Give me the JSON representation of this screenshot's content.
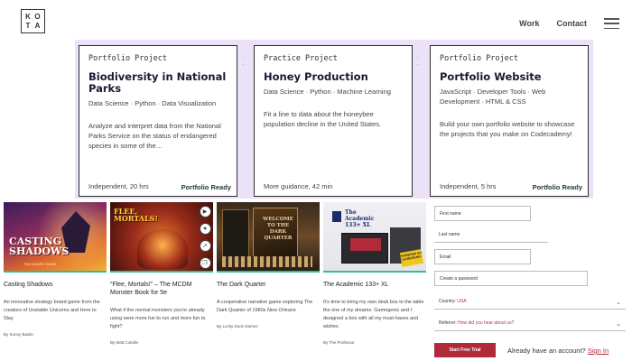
{
  "logo": {
    "letters": [
      "K",
      "O",
      "T",
      "A"
    ]
  },
  "nav": {
    "work": "Work",
    "contact": "Contact",
    "menu_icon": "hamburger-icon"
  },
  "cards": [
    {
      "kicker": "Portfolio Project",
      "title": "Biodiversity in National Parks",
      "tags": "Data Science · Python · Data Visualization",
      "desc": "Analyze and interpret data from the National Parks Service on the status of endangered species in some of the…",
      "meta": "Independent, 20 hrs",
      "badge": "Portfolio Ready"
    },
    {
      "kicker": "Practice Project",
      "title": "Honey Production",
      "tags": "Data Science · Python · Machine Learning",
      "desc": "Fit a line to data about the honeybee population decline in the United States.",
      "meta": "More guidance, 42 min",
      "badge": ""
    },
    {
      "kicker": "Portfolio Project",
      "title": "Portfolio Website",
      "tags": "JavaScript · Developer Tools · Web Development · HTML & CSS",
      "desc": "Build your own portfolio website to showcase the projects that you make on Codecademy!",
      "meta": "Independent, 5 hrs",
      "badge": "Portfolio Ready"
    }
  ],
  "articles": [
    {
      "title": "Casting Shadows",
      "desc": "An innovative strategy board game from the creators of Unstable Unicorns and Here to Slay",
      "by": "By Sunny Basile",
      "thumb_text": "CASTING SHADOWS",
      "thumb_sub": "THE BOARD GAME"
    },
    {
      "title": "“Flee, Mortals!” – The MCDM Monster Book for 5e",
      "desc": "What if the normal monsters you're already using were more fun to run and more fun to fight?",
      "by": "By Matt Colville",
      "thumb_text": "FLEE, MORTALS!"
    },
    {
      "title": "The Dark Quarter",
      "desc": "A cooperative narrative game exploring The Dark Quarter of 1980s New Orleans",
      "by": "By Lucky Duck Games",
      "thumb_text": "WELCOME TO THE DARK QUARTER"
    },
    {
      "title": "The Academic 133+ XL",
      "desc": "It's time to bring my own desk box to the table the one of my dreams. Gamegenic and I designed a box with all my must-haves and wishes",
      "by": "By The Professor",
      "thumb_text": "The Academic 133+ XL",
      "thumb_badge": "POWERED BY GAMEGENIC"
    }
  ],
  "side_icons": [
    "play-icon",
    "heart-icon",
    "share-icon",
    "bookmark-icon"
  ],
  "form": {
    "first_name": "First name",
    "last_name": "Last name",
    "email": "Email",
    "password": "Create a password",
    "country_label": "Country:",
    "country_value": "USA",
    "referrer_label": "Referrer:",
    "referrer_value": "How did you hear about us?",
    "submit": "Start Free Trial",
    "signin_prompt": "Already have an account?",
    "signin_link": "Sign In"
  },
  "colors": {
    "band": "#ece2f8",
    "accent_green": "#2fbf94",
    "cta_red": "#b02a3a"
  }
}
